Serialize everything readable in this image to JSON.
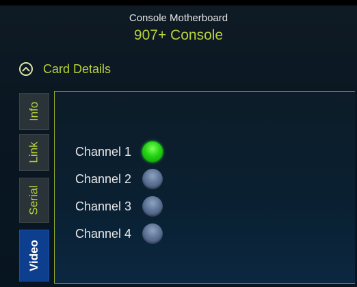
{
  "header": {
    "subtitle": "Console Motherboard",
    "title": "907+ Console"
  },
  "section": {
    "label": "Card Details",
    "icon": "chevron-up-icon"
  },
  "tabs": [
    {
      "label": "Info",
      "active": false
    },
    {
      "label": "Link",
      "active": false
    },
    {
      "label": "Serial",
      "active": false
    },
    {
      "label": "Video",
      "active": true
    }
  ],
  "channels": [
    {
      "label": "Channel 1",
      "status": "on"
    },
    {
      "label": "Channel 2",
      "status": "off"
    },
    {
      "label": "Channel 3",
      "status": "off"
    },
    {
      "label": "Channel 4",
      "status": "off"
    }
  ],
  "colors": {
    "accent": "#b7d23a",
    "led_on": "#23d415",
    "led_off": "#5e7496",
    "active_tab": "#0e3f8e"
  }
}
